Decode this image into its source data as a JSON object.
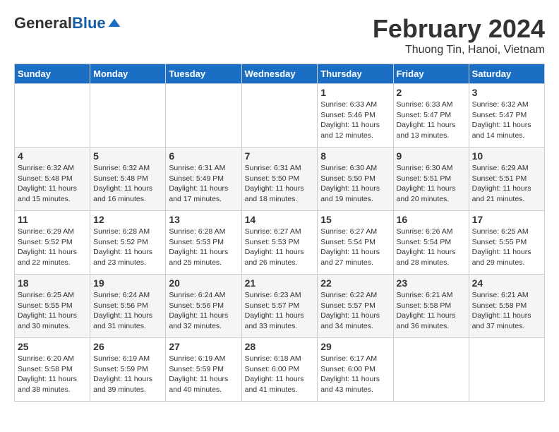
{
  "header": {
    "logo_general": "General",
    "logo_blue": "Blue",
    "title": "February 2024",
    "subtitle": "Thuong Tin, Hanoi, Vietnam"
  },
  "columns": [
    "Sunday",
    "Monday",
    "Tuesday",
    "Wednesday",
    "Thursday",
    "Friday",
    "Saturday"
  ],
  "weeks": [
    [
      {
        "day": "",
        "info": ""
      },
      {
        "day": "",
        "info": ""
      },
      {
        "day": "",
        "info": ""
      },
      {
        "day": "",
        "info": ""
      },
      {
        "day": "1",
        "info": "Sunrise: 6:33 AM\nSunset: 5:46 PM\nDaylight: 11 hours\nand 12 minutes."
      },
      {
        "day": "2",
        "info": "Sunrise: 6:33 AM\nSunset: 5:47 PM\nDaylight: 11 hours\nand 13 minutes."
      },
      {
        "day": "3",
        "info": "Sunrise: 6:32 AM\nSunset: 5:47 PM\nDaylight: 11 hours\nand 14 minutes."
      }
    ],
    [
      {
        "day": "4",
        "info": "Sunrise: 6:32 AM\nSunset: 5:48 PM\nDaylight: 11 hours\nand 15 minutes."
      },
      {
        "day": "5",
        "info": "Sunrise: 6:32 AM\nSunset: 5:48 PM\nDaylight: 11 hours\nand 16 minutes."
      },
      {
        "day": "6",
        "info": "Sunrise: 6:31 AM\nSunset: 5:49 PM\nDaylight: 11 hours\nand 17 minutes."
      },
      {
        "day": "7",
        "info": "Sunrise: 6:31 AM\nSunset: 5:50 PM\nDaylight: 11 hours\nand 18 minutes."
      },
      {
        "day": "8",
        "info": "Sunrise: 6:30 AM\nSunset: 5:50 PM\nDaylight: 11 hours\nand 19 minutes."
      },
      {
        "day": "9",
        "info": "Sunrise: 6:30 AM\nSunset: 5:51 PM\nDaylight: 11 hours\nand 20 minutes."
      },
      {
        "day": "10",
        "info": "Sunrise: 6:29 AM\nSunset: 5:51 PM\nDaylight: 11 hours\nand 21 minutes."
      }
    ],
    [
      {
        "day": "11",
        "info": "Sunrise: 6:29 AM\nSunset: 5:52 PM\nDaylight: 11 hours\nand 22 minutes."
      },
      {
        "day": "12",
        "info": "Sunrise: 6:28 AM\nSunset: 5:52 PM\nDaylight: 11 hours\nand 23 minutes."
      },
      {
        "day": "13",
        "info": "Sunrise: 6:28 AM\nSunset: 5:53 PM\nDaylight: 11 hours\nand 25 minutes."
      },
      {
        "day": "14",
        "info": "Sunrise: 6:27 AM\nSunset: 5:53 PM\nDaylight: 11 hours\nand 26 minutes."
      },
      {
        "day": "15",
        "info": "Sunrise: 6:27 AM\nSunset: 5:54 PM\nDaylight: 11 hours\nand 27 minutes."
      },
      {
        "day": "16",
        "info": "Sunrise: 6:26 AM\nSunset: 5:54 PM\nDaylight: 11 hours\nand 28 minutes."
      },
      {
        "day": "17",
        "info": "Sunrise: 6:25 AM\nSunset: 5:55 PM\nDaylight: 11 hours\nand 29 minutes."
      }
    ],
    [
      {
        "day": "18",
        "info": "Sunrise: 6:25 AM\nSunset: 5:55 PM\nDaylight: 11 hours\nand 30 minutes."
      },
      {
        "day": "19",
        "info": "Sunrise: 6:24 AM\nSunset: 5:56 PM\nDaylight: 11 hours\nand 31 minutes."
      },
      {
        "day": "20",
        "info": "Sunrise: 6:24 AM\nSunset: 5:56 PM\nDaylight: 11 hours\nand 32 minutes."
      },
      {
        "day": "21",
        "info": "Sunrise: 6:23 AM\nSunset: 5:57 PM\nDaylight: 11 hours\nand 33 minutes."
      },
      {
        "day": "22",
        "info": "Sunrise: 6:22 AM\nSunset: 5:57 PM\nDaylight: 11 hours\nand 34 minutes."
      },
      {
        "day": "23",
        "info": "Sunrise: 6:21 AM\nSunset: 5:58 PM\nDaylight: 11 hours\nand 36 minutes."
      },
      {
        "day": "24",
        "info": "Sunrise: 6:21 AM\nSunset: 5:58 PM\nDaylight: 11 hours\nand 37 minutes."
      }
    ],
    [
      {
        "day": "25",
        "info": "Sunrise: 6:20 AM\nSunset: 5:58 PM\nDaylight: 11 hours\nand 38 minutes."
      },
      {
        "day": "26",
        "info": "Sunrise: 6:19 AM\nSunset: 5:59 PM\nDaylight: 11 hours\nand 39 minutes."
      },
      {
        "day": "27",
        "info": "Sunrise: 6:19 AM\nSunset: 5:59 PM\nDaylight: 11 hours\nand 40 minutes."
      },
      {
        "day": "28",
        "info": "Sunrise: 6:18 AM\nSunset: 6:00 PM\nDaylight: 11 hours\nand 41 minutes."
      },
      {
        "day": "29",
        "info": "Sunrise: 6:17 AM\nSunset: 6:00 PM\nDaylight: 11 hours\nand 43 minutes."
      },
      {
        "day": "",
        "info": ""
      },
      {
        "day": "",
        "info": ""
      }
    ]
  ]
}
